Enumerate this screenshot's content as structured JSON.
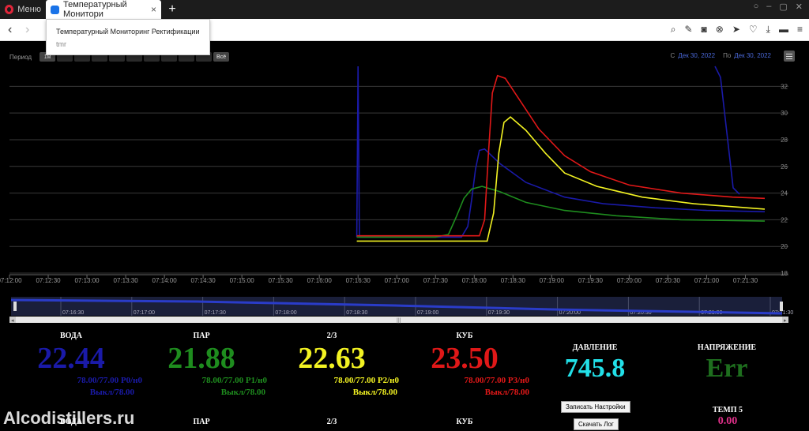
{
  "browser": {
    "menu_label": "Меню",
    "tab_title": "Температурный Монитори",
    "tab_close": "×",
    "new_tab": "+",
    "dropdown_title": "Температурный Мониторинг Ректификации",
    "dropdown_url": "tmr"
  },
  "toolbar": {
    "period_label": "Период",
    "period_buttons": [
      "1м",
      "",
      "",
      "",
      "",
      "",
      "",
      "",
      "",
      "",
      "Всё"
    ],
    "from_label": "С",
    "from_date": "Дек 30, 2022",
    "to_label": "По",
    "to_date": "Дек 30, 2022"
  },
  "chart_data": {
    "type": "line",
    "x_ticks": [
      "07:12:00",
      "07:12:30",
      "07:13:00",
      "07:13:30",
      "07:14:00",
      "07:14:30",
      "07:15:00",
      "07:15:30",
      "07:16:00",
      "07:16:30",
      "07:17:00",
      "07:17:30",
      "07:18:00",
      "07:18:30",
      "07:19:00",
      "07:19:30",
      "07:20:00",
      "07:20:30",
      "07:21:00",
      "07:21:30"
    ],
    "y_ticks": [
      18,
      20,
      22,
      24,
      26,
      28,
      30,
      32
    ],
    "ylim": [
      18,
      33.5
    ],
    "xlim_seconds": [
      0,
      585
    ],
    "series": [
      {
        "color": "#1a1aa8",
        "points": [
          [
            269,
            20.7
          ],
          [
            270,
            33.5
          ],
          [
            271,
            20.7
          ],
          [
            340,
            20.7
          ],
          [
            350,
            20.7
          ],
          [
            355,
            21.5
          ],
          [
            358,
            23.5
          ],
          [
            361,
            25.8
          ],
          [
            364,
            27.2
          ],
          [
            368,
            27.3
          ],
          [
            380,
            26.2
          ],
          [
            400,
            24.8
          ],
          [
            430,
            23.7
          ],
          [
            460,
            23.2
          ],
          [
            500,
            22.9
          ],
          [
            540,
            22.7
          ],
          [
            585,
            22.6
          ]
        ]
      },
      {
        "color": "#1e8c1e",
        "points": [
          [
            269,
            20.7
          ],
          [
            330,
            20.7
          ],
          [
            340,
            20.9
          ],
          [
            346,
            22.2
          ],
          [
            352,
            23.6
          ],
          [
            358,
            24.3
          ],
          [
            366,
            24.5
          ],
          [
            380,
            24.1
          ],
          [
            400,
            23.3
          ],
          [
            430,
            22.7
          ],
          [
            470,
            22.3
          ],
          [
            520,
            22.0
          ],
          [
            585,
            21.9
          ]
        ]
      },
      {
        "color": "#e01818",
        "points": [
          [
            269,
            20.8
          ],
          [
            364,
            20.8
          ],
          [
            368,
            22.0
          ],
          [
            371,
            27.0
          ],
          [
            374,
            31.5
          ],
          [
            378,
            32.8
          ],
          [
            384,
            32.6
          ],
          [
            395,
            31.0
          ],
          [
            410,
            28.8
          ],
          [
            430,
            26.8
          ],
          [
            450,
            25.6
          ],
          [
            480,
            24.6
          ],
          [
            520,
            24.0
          ],
          [
            560,
            23.7
          ],
          [
            585,
            23.6
          ]
        ]
      },
      {
        "color": "#f2f222",
        "points": [
          [
            269,
            20.4
          ],
          [
            370,
            20.4
          ],
          [
            375,
            22.5
          ],
          [
            379,
            27.0
          ],
          [
            383,
            29.3
          ],
          [
            388,
            29.7
          ],
          [
            400,
            28.7
          ],
          [
            415,
            27.0
          ],
          [
            430,
            25.5
          ],
          [
            455,
            24.5
          ],
          [
            490,
            23.7
          ],
          [
            530,
            23.2
          ],
          [
            585,
            22.8
          ]
        ]
      }
    ],
    "navigator_ticks": [
      "07:16:30",
      "07:17:00",
      "07:17:30",
      "07:18:00",
      "07:18:30",
      "07:19:00",
      "07:19:30",
      "07:20:00",
      "07:20:30",
      "07:21:00",
      "07:21:30"
    ]
  },
  "readouts": {
    "voda": {
      "label": "ВОДА",
      "value": "22.44",
      "line1": "78.00/77.00 Р0/н0",
      "line2": "Выкл/78.00",
      "color": "#1a1aa8"
    },
    "par": {
      "label": "ПАР",
      "value": "21.88",
      "line1": "78.00/77.00 Р1/н0",
      "line2": "Выкл/78.00",
      "color": "#1e8c1e"
    },
    "two_three": {
      "label": "2/3",
      "value": "22.63",
      "line1": "78.00/77.00 Р2/н0",
      "line2": "Выкл/78.00",
      "color": "#f2f222"
    },
    "kub": {
      "label": "КУБ",
      "value": "23.50",
      "line1": "78.00/77.00 Р3/н0",
      "line2": "Выкл/78.00",
      "color": "#e01818"
    },
    "pressure": {
      "label": "ДАВЛЕНИЕ",
      "value": "745.8",
      "color": "#22e0e8"
    },
    "voltage": {
      "label": "НАПРЯЖЕНИЕ",
      "value": "Err",
      "color": "#1e6e1e"
    },
    "temp5": {
      "label": "ТЕМП 5",
      "value": "0.00",
      "color": "#e0308a"
    },
    "save_settings": "Записать Настройки",
    "download_log": "Скачать Лог",
    "row2_labels": [
      "ВОДА",
      "ПАР",
      "2/3",
      "КУБ"
    ]
  },
  "watermark": "Alcodistillers.ru"
}
